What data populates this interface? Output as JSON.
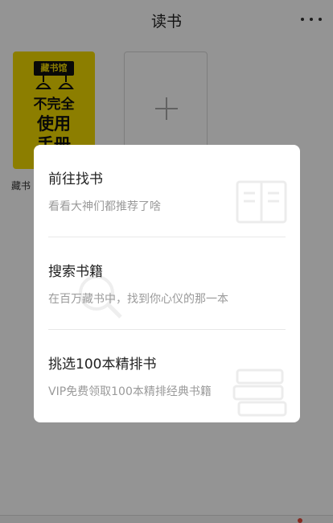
{
  "header": {
    "title": "读书"
  },
  "shelf": {
    "book": {
      "cover_badge": "藏书馆",
      "cover_line1": "不完全",
      "cover_line2": "使用",
      "cover_line3": "手册",
      "label": "藏书"
    }
  },
  "popup": {
    "items": [
      {
        "title": "前往找书",
        "subtitle": "看看大神们都推荐了啥",
        "icon": "open-book-icon"
      },
      {
        "title": "搜索书籍",
        "subtitle": "在百万藏书中，找到你心仪的那一本",
        "icon": "magnifier-icon"
      },
      {
        "title": "挑选100本精排书",
        "subtitle": "VIP免费领取100本精排经典书籍",
        "icon": "book-stack-icon"
      }
    ]
  },
  "colors": {
    "cover_yellow": "#f2d900",
    "overlay": "rgba(0,0,0,0.42)",
    "badge_dot": "#e64a3a"
  }
}
